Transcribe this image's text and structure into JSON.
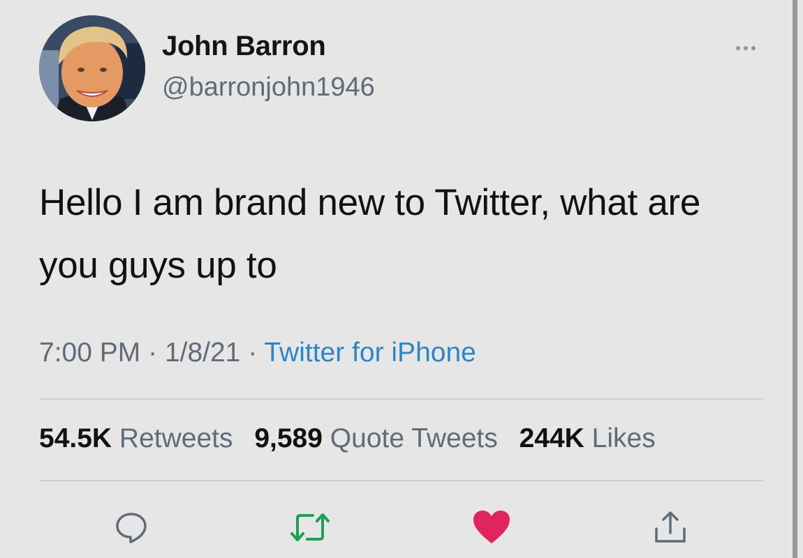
{
  "author": {
    "name": "John Barron",
    "handle": "@barronjohn1946",
    "avatar_icon": "profile-photo"
  },
  "tweet": {
    "text": "Hello I am brand new to Twitter, what are you guys up to",
    "time": "7:00 PM",
    "date": "1/8/21",
    "separator": "·",
    "source": "Twitter for iPhone"
  },
  "stats": {
    "retweets_count": "54.5K",
    "retweets_label": "Retweets",
    "quotes_count": "9,589",
    "quotes_label": "Quote Tweets",
    "likes_count": "244K",
    "likes_label": "Likes"
  },
  "actions": {
    "reply_icon": "speech-bubble",
    "retweet_icon": "retweet-arrows",
    "like_icon": "heart",
    "share_icon": "share-upload"
  },
  "colors": {
    "background": "#e6e6e6",
    "link": "#2a86c7",
    "muted_text": "#5f6b77",
    "retweet_green": "#1f9d55",
    "like_red": "#e0245e"
  }
}
